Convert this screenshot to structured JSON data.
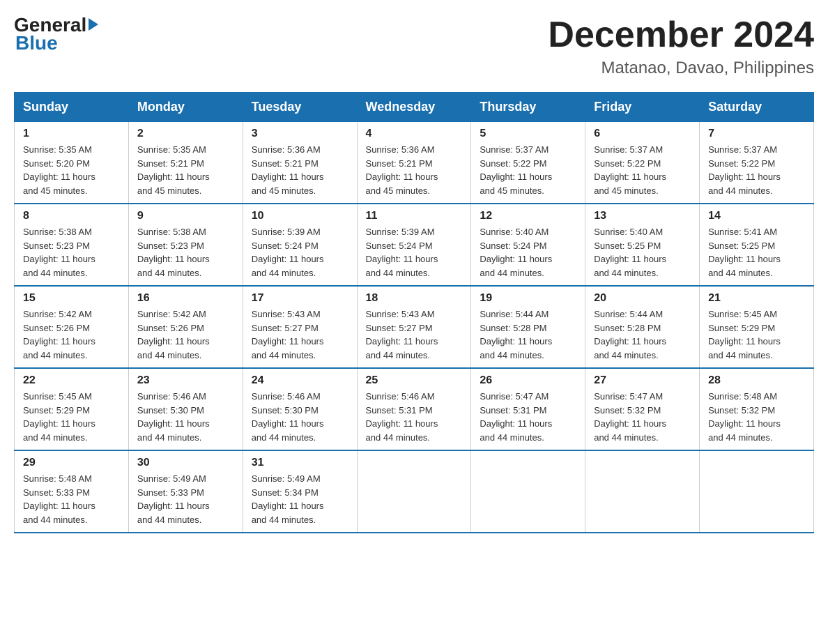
{
  "logo": {
    "general": "General",
    "blue": "Blue"
  },
  "title": {
    "month": "December 2024",
    "location": "Matanao, Davao, Philippines"
  },
  "headers": [
    "Sunday",
    "Monday",
    "Tuesday",
    "Wednesday",
    "Thursday",
    "Friday",
    "Saturday"
  ],
  "weeks": [
    [
      {
        "day": "1",
        "sunrise": "5:35 AM",
        "sunset": "5:20 PM",
        "daylight": "11 hours and 45 minutes."
      },
      {
        "day": "2",
        "sunrise": "5:35 AM",
        "sunset": "5:21 PM",
        "daylight": "11 hours and 45 minutes."
      },
      {
        "day": "3",
        "sunrise": "5:36 AM",
        "sunset": "5:21 PM",
        "daylight": "11 hours and 45 minutes."
      },
      {
        "day": "4",
        "sunrise": "5:36 AM",
        "sunset": "5:21 PM",
        "daylight": "11 hours and 45 minutes."
      },
      {
        "day": "5",
        "sunrise": "5:37 AM",
        "sunset": "5:22 PM",
        "daylight": "11 hours and 45 minutes."
      },
      {
        "day": "6",
        "sunrise": "5:37 AM",
        "sunset": "5:22 PM",
        "daylight": "11 hours and 45 minutes."
      },
      {
        "day": "7",
        "sunrise": "5:37 AM",
        "sunset": "5:22 PM",
        "daylight": "11 hours and 44 minutes."
      }
    ],
    [
      {
        "day": "8",
        "sunrise": "5:38 AM",
        "sunset": "5:23 PM",
        "daylight": "11 hours and 44 minutes."
      },
      {
        "day": "9",
        "sunrise": "5:38 AM",
        "sunset": "5:23 PM",
        "daylight": "11 hours and 44 minutes."
      },
      {
        "day": "10",
        "sunrise": "5:39 AM",
        "sunset": "5:24 PM",
        "daylight": "11 hours and 44 minutes."
      },
      {
        "day": "11",
        "sunrise": "5:39 AM",
        "sunset": "5:24 PM",
        "daylight": "11 hours and 44 minutes."
      },
      {
        "day": "12",
        "sunrise": "5:40 AM",
        "sunset": "5:24 PM",
        "daylight": "11 hours and 44 minutes."
      },
      {
        "day": "13",
        "sunrise": "5:40 AM",
        "sunset": "5:25 PM",
        "daylight": "11 hours and 44 minutes."
      },
      {
        "day": "14",
        "sunrise": "5:41 AM",
        "sunset": "5:25 PM",
        "daylight": "11 hours and 44 minutes."
      }
    ],
    [
      {
        "day": "15",
        "sunrise": "5:42 AM",
        "sunset": "5:26 PM",
        "daylight": "11 hours and 44 minutes."
      },
      {
        "day": "16",
        "sunrise": "5:42 AM",
        "sunset": "5:26 PM",
        "daylight": "11 hours and 44 minutes."
      },
      {
        "day": "17",
        "sunrise": "5:43 AM",
        "sunset": "5:27 PM",
        "daylight": "11 hours and 44 minutes."
      },
      {
        "day": "18",
        "sunrise": "5:43 AM",
        "sunset": "5:27 PM",
        "daylight": "11 hours and 44 minutes."
      },
      {
        "day": "19",
        "sunrise": "5:44 AM",
        "sunset": "5:28 PM",
        "daylight": "11 hours and 44 minutes."
      },
      {
        "day": "20",
        "sunrise": "5:44 AM",
        "sunset": "5:28 PM",
        "daylight": "11 hours and 44 minutes."
      },
      {
        "day": "21",
        "sunrise": "5:45 AM",
        "sunset": "5:29 PM",
        "daylight": "11 hours and 44 minutes."
      }
    ],
    [
      {
        "day": "22",
        "sunrise": "5:45 AM",
        "sunset": "5:29 PM",
        "daylight": "11 hours and 44 minutes."
      },
      {
        "day": "23",
        "sunrise": "5:46 AM",
        "sunset": "5:30 PM",
        "daylight": "11 hours and 44 minutes."
      },
      {
        "day": "24",
        "sunrise": "5:46 AM",
        "sunset": "5:30 PM",
        "daylight": "11 hours and 44 minutes."
      },
      {
        "day": "25",
        "sunrise": "5:46 AM",
        "sunset": "5:31 PM",
        "daylight": "11 hours and 44 minutes."
      },
      {
        "day": "26",
        "sunrise": "5:47 AM",
        "sunset": "5:31 PM",
        "daylight": "11 hours and 44 minutes."
      },
      {
        "day": "27",
        "sunrise": "5:47 AM",
        "sunset": "5:32 PM",
        "daylight": "11 hours and 44 minutes."
      },
      {
        "day": "28",
        "sunrise": "5:48 AM",
        "sunset": "5:32 PM",
        "daylight": "11 hours and 44 minutes."
      }
    ],
    [
      {
        "day": "29",
        "sunrise": "5:48 AM",
        "sunset": "5:33 PM",
        "daylight": "11 hours and 44 minutes."
      },
      {
        "day": "30",
        "sunrise": "5:49 AM",
        "sunset": "5:33 PM",
        "daylight": "11 hours and 44 minutes."
      },
      {
        "day": "31",
        "sunrise": "5:49 AM",
        "sunset": "5:34 PM",
        "daylight": "11 hours and 44 minutes."
      },
      null,
      null,
      null,
      null
    ]
  ],
  "labels": {
    "sunrise": "Sunrise:",
    "sunset": "Sunset:",
    "daylight": "Daylight:"
  }
}
